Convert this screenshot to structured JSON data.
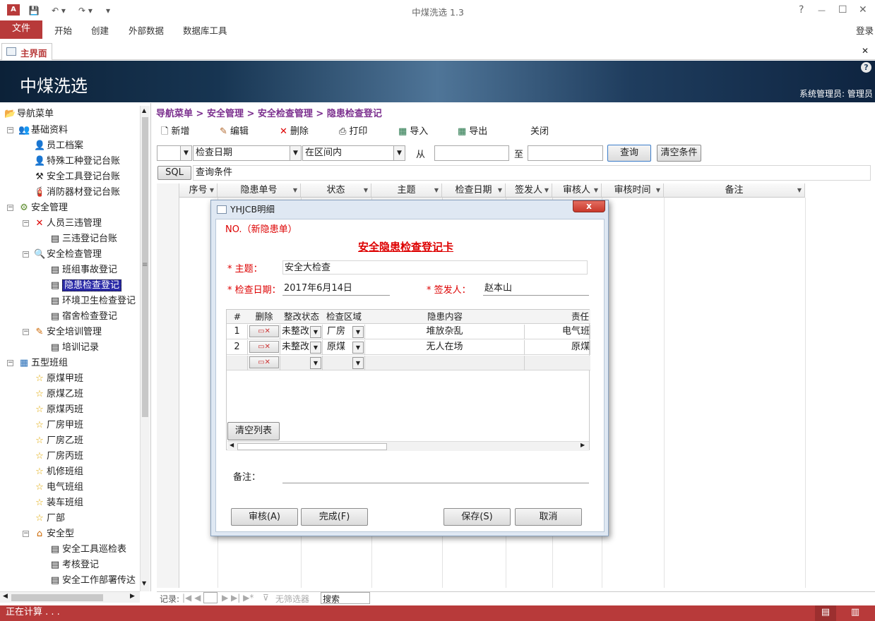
{
  "titlebar": {
    "title": "中煤洗选 1.3",
    "help": "?",
    "minimize": "—",
    "maximize": "☐",
    "close": "✕"
  },
  "ribbon": {
    "file": "文件",
    "tabs": [
      "开始",
      "创建",
      "外部数据",
      "数据库工具"
    ],
    "login": "登录"
  },
  "doc_tab": {
    "label": "主界面",
    "close": "✕"
  },
  "banner": {
    "app_name": "中煤洗选",
    "help": "?",
    "user": "系统管理员: 管理员"
  },
  "nav": {
    "root": "导航菜单",
    "items": [
      {
        "label": "基础资料"
      },
      {
        "label": "员工档案"
      },
      {
        "label": "特殊工种登记台账"
      },
      {
        "label": "安全工具登记台账"
      },
      {
        "label": "消防器材登记台账"
      },
      {
        "label": "安全管理"
      },
      {
        "label": "人员三违管理"
      },
      {
        "label": "三违登记台账"
      },
      {
        "label": "安全检查管理"
      },
      {
        "label": "班组事故登记"
      },
      {
        "label": "隐患检查登记"
      },
      {
        "label": "环境卫生检查登记"
      },
      {
        "label": "宿舍检查登记"
      },
      {
        "label": "安全培训管理"
      },
      {
        "label": "培训记录"
      },
      {
        "label": "五型班组"
      },
      {
        "label": "原煤甲班"
      },
      {
        "label": "原煤乙班"
      },
      {
        "label": "原煤丙班"
      },
      {
        "label": "厂房甲班"
      },
      {
        "label": "厂房乙班"
      },
      {
        "label": "厂房丙班"
      },
      {
        "label": "机修班组"
      },
      {
        "label": "电气班组"
      },
      {
        "label": "装车班组"
      },
      {
        "label": "厂部"
      },
      {
        "label": "安全型"
      },
      {
        "label": "安全工具巡检表"
      },
      {
        "label": "考核登记"
      },
      {
        "label": "安全工作部署传达"
      }
    ]
  },
  "breadcrumb": "导航菜单 > 安全管理 > 安全检查管理 > 隐患检查登记",
  "toolbar": {
    "new": "新增",
    "edit": "编辑",
    "delete": "删除",
    "print": "打印",
    "import": "导入",
    "export": "导出",
    "close": "关闭"
  },
  "filter": {
    "field": "检查日期",
    "operator": "在区间内",
    "from_label": "从",
    "to_label": "至",
    "from_value": "",
    "to_value": "",
    "query": "查询",
    "clear": "清空条件",
    "sql": "SQL",
    "sql_text": "查询条件"
  },
  "columns": [
    "序号",
    "隐患单号",
    "状态",
    "主题",
    "检查日期",
    "签发人",
    "审核人",
    "审核时间",
    "备注"
  ],
  "record_nav": {
    "label": "记录:",
    "filter": "无筛选器",
    "search": "搜索"
  },
  "status_bar": "正在计算 . . .",
  "modal": {
    "title": "YHJCB明细",
    "close": "x",
    "no_label": "NO.（新隐患单）",
    "card_title": "安全隐患检查登记卡",
    "subject_label": "* 主题：",
    "subject_value": "安全大检查",
    "date_label": "* 检查日期：",
    "date_value": "2017年6月14日",
    "issuer_label": "* 签发人：",
    "issuer_value": "赵本山",
    "subgrid": {
      "headers": [
        "#",
        "删除",
        "整改状态",
        "检查区域",
        "隐患内容",
        "责任"
      ],
      "rows": [
        {
          "no": "1",
          "status": "未整改",
          "area": "厂房",
          "content": "堆放杂乱",
          "resp": "电气班"
        },
        {
          "no": "2",
          "status": "未整改",
          "area": "原煤",
          "content": "无人在场",
          "resp": "原煤"
        }
      ]
    },
    "clear_list": "清空列表",
    "remark_label": "备注：",
    "remark_value": "",
    "buttons": {
      "review": "审核(A)",
      "complete": "完成(F)",
      "save": "保存(S)",
      "cancel": "取消"
    }
  }
}
